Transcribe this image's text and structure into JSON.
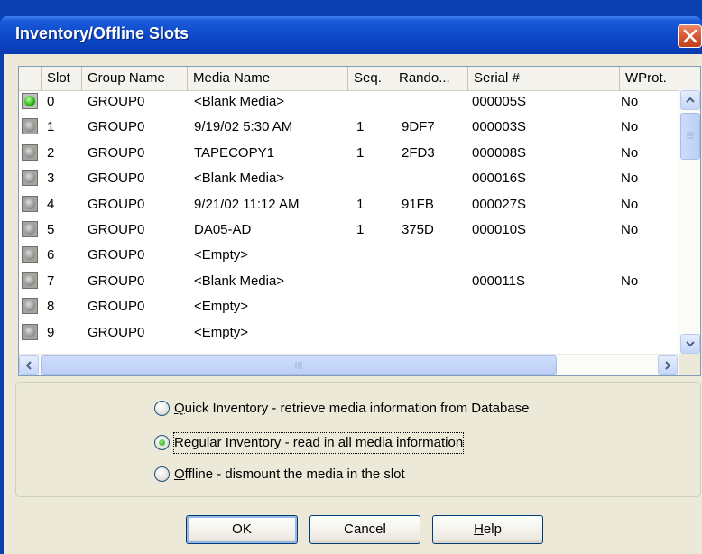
{
  "window": {
    "title": "Inventory/Offline Slots"
  },
  "table": {
    "columns": [
      "",
      "Slot",
      "Group Name",
      "Media Name",
      "Seq.",
      "Rando...",
      "Serial #",
      "WProt."
    ],
    "rows": [
      {
        "slot": "0",
        "group": "GROUP0",
        "media": "<Blank Media>",
        "seq": "",
        "rando": "",
        "serial": "000005S",
        "wprot": "No",
        "active": true
      },
      {
        "slot": "1",
        "group": "GROUP0",
        "media": "9/19/02 5:30 AM",
        "seq": "1",
        "rando": "9DF7",
        "serial": "000003S",
        "wprot": "No",
        "active": false
      },
      {
        "slot": "2",
        "group": "GROUP0",
        "media": "TAPECOPY1",
        "seq": "1",
        "rando": "2FD3",
        "serial": "000008S",
        "wprot": "No",
        "active": false
      },
      {
        "slot": "3",
        "group": "GROUP0",
        "media": "<Blank Media>",
        "seq": "",
        "rando": "",
        "serial": "000016S",
        "wprot": "No",
        "active": false
      },
      {
        "slot": "4",
        "group": "GROUP0",
        "media": "9/21/02 11:12 AM",
        "seq": "1",
        "rando": "91FB",
        "serial": "000027S",
        "wprot": "No",
        "active": false
      },
      {
        "slot": "5",
        "group": "GROUP0",
        "media": "DA05-AD",
        "seq": "1",
        "rando": "375D",
        "serial": "000010S",
        "wprot": "No",
        "active": false
      },
      {
        "slot": "6",
        "group": "GROUP0",
        "media": "<Empty>",
        "seq": "",
        "rando": "",
        "serial": "",
        "wprot": "",
        "active": false
      },
      {
        "slot": "7",
        "group": "GROUP0",
        "media": "<Blank Media>",
        "seq": "",
        "rando": "",
        "serial": "000011S",
        "wprot": "No",
        "active": false
      },
      {
        "slot": "8",
        "group": "GROUP0",
        "media": "<Empty>",
        "seq": "",
        "rando": "",
        "serial": "",
        "wprot": "",
        "active": false
      },
      {
        "slot": "9",
        "group": "GROUP0",
        "media": "<Empty>",
        "seq": "",
        "rando": "",
        "serial": "",
        "wprot": "",
        "active": false
      }
    ]
  },
  "options": [
    {
      "mnemonic": "Q",
      "rest": "uick Inventory - retrieve media information from Database",
      "checked": false
    },
    {
      "mnemonic": "R",
      "rest": "egular Inventory - read in all media information",
      "checked": true
    },
    {
      "mnemonic": "O",
      "rest": "ffline - dismount the media in the slot",
      "checked": false
    }
  ],
  "buttons": {
    "ok": "OK",
    "cancel": "Cancel",
    "help_mnemonic": "H",
    "help_rest": "elp"
  },
  "icons": {
    "close": "close-icon",
    "slot_active": "slot-active-icon",
    "slot_idle": "slot-icon"
  }
}
